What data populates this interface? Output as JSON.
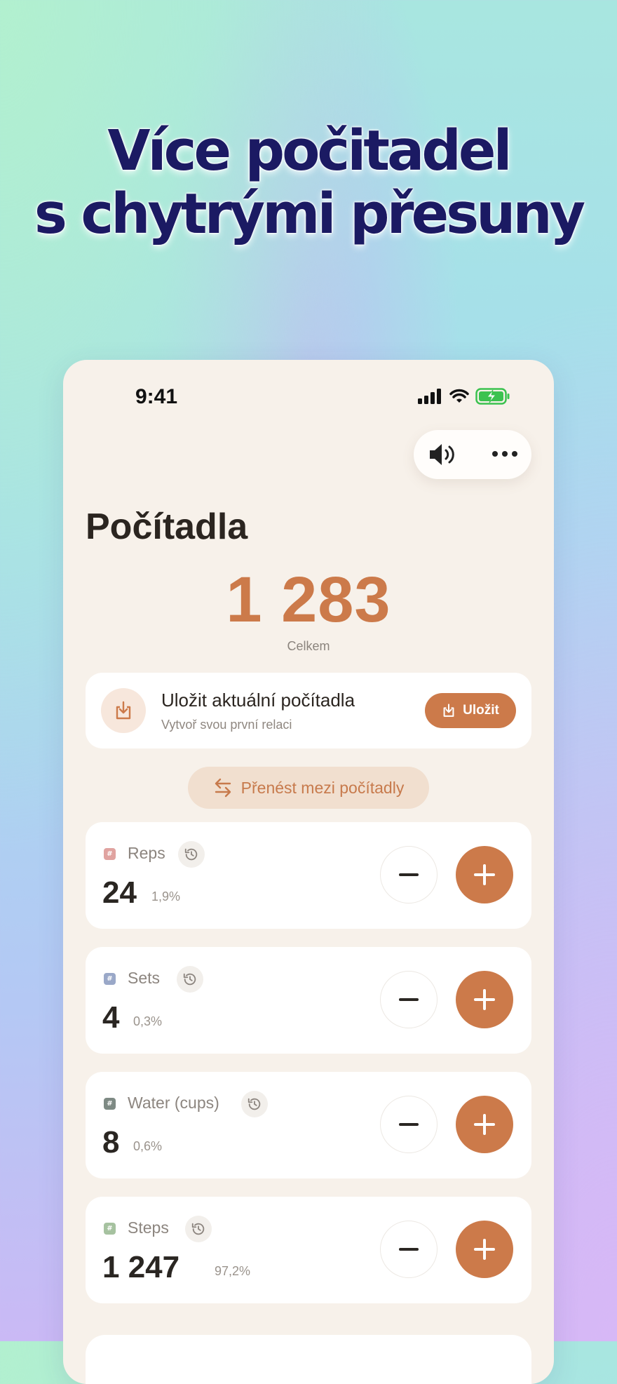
{
  "headline": {
    "line1": "Více počitadel",
    "line2": "s chytrými přesuny"
  },
  "status_bar": {
    "time": "9:41"
  },
  "toolbar": {
    "icons": [
      "speaker-icon",
      "more-icon"
    ]
  },
  "page": {
    "title": "Počítadla",
    "total_value": "1 283",
    "total_label": "Celkem"
  },
  "save_card": {
    "title": "Uložit aktuální počítadla",
    "subtitle": "Vytvoř svou první relaci",
    "button_label": "Uložit"
  },
  "transfer": {
    "label": "Přenést mezi počítadly"
  },
  "colors": {
    "accent": "#cc7a4a",
    "headline": "#1b1a63"
  },
  "counters": [
    {
      "name": "Reps",
      "value": "24",
      "percent": "1,9%",
      "tag_color": "#e0a3a0"
    },
    {
      "name": "Sets",
      "value": "4",
      "percent": "0,3%",
      "tag_color": "#9aa8c8"
    },
    {
      "name": "Water (cups)",
      "value": "8",
      "percent": "0,6%",
      "tag_color": "#7e8a84"
    },
    {
      "name": "Steps",
      "value": "1 247",
      "percent": "97,2%",
      "tag_color": "#a6c2a0"
    }
  ]
}
